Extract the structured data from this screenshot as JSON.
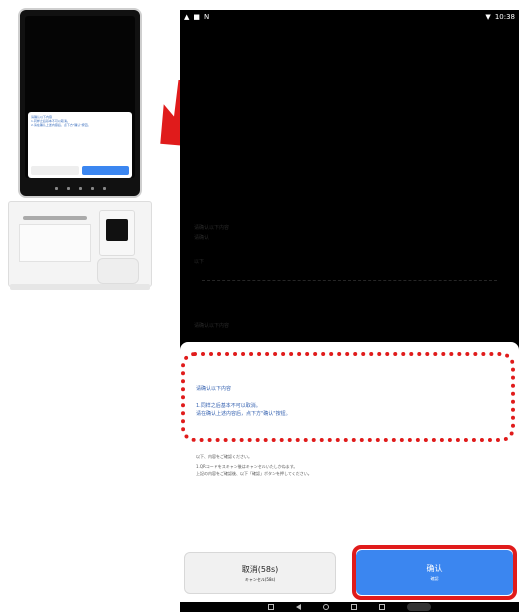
{
  "device_illustration": {
    "mini_dialog_lines": [
      "请确认以下内容",
      "1.同样之后基本不可以取消。",
      "2.请在确认上述内容后，点下方\"确认\"按钮。"
    ]
  },
  "status_bar": {
    "left_icons": [
      "warning-icon",
      "notification-icon",
      "n-icon"
    ],
    "time": "10:38"
  },
  "background": {
    "lines": [
      "请确认以下内容",
      "请确认",
      "以下",
      "请确认以下内容"
    ]
  },
  "dialog": {
    "title": "请确认以下内容",
    "lines": [
      "1.同样之后基本不可以取消。",
      "请在确认上述内容后，点下方\"确认\"按钮。"
    ],
    "notes": [
      "以下、内容をご確認ください。",
      "1.QRコードをスキャン後はキャンセルいたしかねます。",
      "上記の内容をご確認後、以下「確認」ボタンを押してください。"
    ],
    "cancel_button": {
      "label": "取消(58s)",
      "sublabel": "キャンセル(58s)"
    },
    "confirm_button": {
      "label": "确认",
      "sublabel": "確認"
    }
  },
  "colors": {
    "accent_blue": "#3b86f0",
    "highlight_red": "#e01b1b",
    "text_blue": "#3461b0"
  }
}
